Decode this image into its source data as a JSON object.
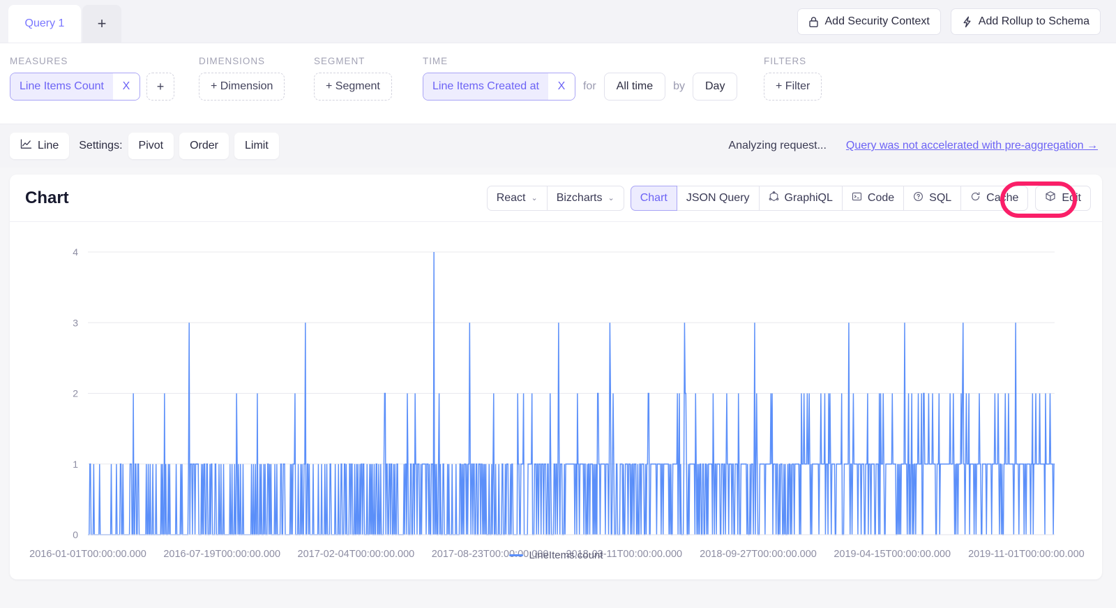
{
  "tabs": {
    "items": [
      {
        "label": "Query 1",
        "active": true
      }
    ],
    "add_label": "+"
  },
  "header_actions": [
    {
      "label": "Add Security Context",
      "icon": "lock-icon"
    },
    {
      "label": "Add Rollup to Schema",
      "icon": "bolt-icon"
    }
  ],
  "builder": {
    "measures": {
      "title": "MEASURES",
      "pill": {
        "label": "Line Items Count",
        "remove": "X"
      },
      "add": "+"
    },
    "dimensions": {
      "title": "DIMENSIONS",
      "add": "+ Dimension"
    },
    "segment": {
      "title": "SEGMENT",
      "add": "+ Segment"
    },
    "time": {
      "title": "TIME",
      "pill": {
        "label": "Line Items Created at",
        "remove": "X"
      },
      "for_label": "for",
      "range": "All time",
      "by_label": "by",
      "granularity": "Day"
    },
    "filters": {
      "title": "FILTERS",
      "add": "+ Filter"
    }
  },
  "settings": {
    "chart_type": "Line",
    "chart_type_icon": "line-chart-icon",
    "label": "Settings:",
    "buttons": [
      "Pivot",
      "Order",
      "Limit"
    ],
    "status": "Analyzing request...",
    "accel_link": "Query was not accelerated with pre-aggregation →"
  },
  "chart_card": {
    "title": "Chart",
    "framework": {
      "label": "React",
      "chevron": "⌄"
    },
    "library": {
      "label": "Bizcharts",
      "chevron": "⌄"
    },
    "views": [
      {
        "label": "Chart",
        "selected": true,
        "icon": null
      },
      {
        "label": "JSON Query",
        "selected": false,
        "icon": null
      },
      {
        "label": "GraphiQL",
        "selected": false,
        "icon": "graphql-icon"
      },
      {
        "label": "Code",
        "selected": false,
        "icon": "terminal-icon"
      },
      {
        "label": "SQL",
        "selected": false,
        "icon": "question-circle-icon"
      },
      {
        "label": "Cache",
        "selected": false,
        "icon": "refresh-icon"
      }
    ],
    "edit": {
      "label": "Edit",
      "icon": "cube-icon",
      "highlighted": true
    }
  },
  "highlight_color": "#fa1f68",
  "accent_color": "#6c63f5",
  "series_color": "#5b8ff9",
  "chart_data": {
    "type": "line",
    "title": "",
    "xlabel": "",
    "ylabel": "",
    "ylim": [
      0,
      4
    ],
    "yticks": [
      "0",
      "1",
      "2",
      "3",
      "4"
    ],
    "xticks": [
      "2016-01-01T00:00:00.000",
      "2016-07-19T00:00:00.000",
      "2017-02-04T00:00:00.000",
      "2017-08-23T00:00:00.000",
      "2018-03-11T00:00:00.000",
      "2018-09-27T00:00:00.000",
      "2019-04-15T00:00:00.000",
      "2019-11-01T00:00:00.000"
    ],
    "grid": true,
    "legend": {
      "position": "bottom",
      "entries": [
        "LineItems.count"
      ]
    },
    "series": [
      {
        "name": "LineItems.count",
        "color": "#5b8ff9",
        "x_start": "2016-01-01T00:00:00.000",
        "x_end": "2020-01-31T00:00:00.000",
        "granularity": "Day",
        "n_points": 1490,
        "y_min": 0,
        "y_max": 4,
        "notable_peaks": [
          {
            "x": "2017-09-10T00:00:00.000",
            "y": 4
          },
          {
            "x": "2016-04-02T00:00:00.000",
            "y": 3
          },
          {
            "x": "2017-12-05T00:00:00.000",
            "y": 3
          },
          {
            "x": "2018-05-19T00:00:00.000",
            "y": 3
          },
          {
            "x": "2018-06-02T00:00:00.000",
            "y": 3
          },
          {
            "x": "2019-05-07T00:00:00.000",
            "y": 3
          },
          {
            "x": "2019-08-22T00:00:00.000",
            "y": 3
          },
          {
            "x": "2019-10-30T00:00:00.000",
            "y": 3
          }
        ],
        "description": "Daily line item counts; mostly 0 or 1 with frequent spikes to 2, occasional 3, and a single 4."
      }
    ]
  }
}
